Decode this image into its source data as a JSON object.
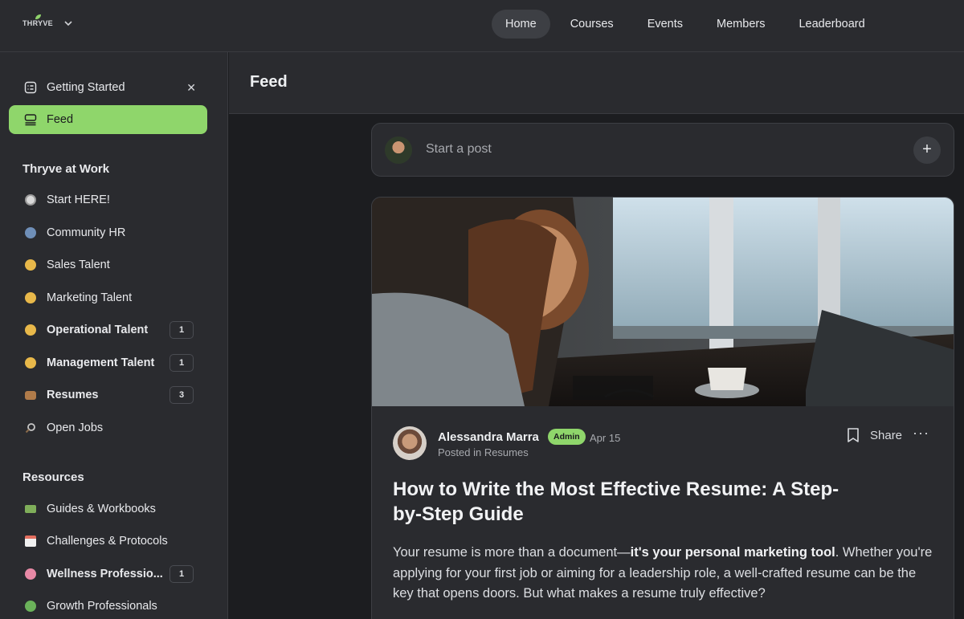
{
  "brand": {
    "logo_text": "THRYVE"
  },
  "nav": {
    "items": [
      {
        "label": "Home",
        "active": true
      },
      {
        "label": "Courses"
      },
      {
        "label": "Events"
      },
      {
        "label": "Members"
      },
      {
        "label": "Leaderboard"
      }
    ]
  },
  "sidebar": {
    "getting_started": "Getting Started",
    "feed": "Feed",
    "section1": "Thryve at Work",
    "section1_items": [
      {
        "label": "Start HERE!",
        "icon": "compass-icon",
        "color": "#d9d9d9"
      },
      {
        "label": "Community HR",
        "icon": "speech-icon",
        "color": "#6f8fb8"
      },
      {
        "label": "Sales Talent",
        "icon": "money-face-icon",
        "color": "#e8b84a"
      },
      {
        "label": "Marketing Talent",
        "icon": "smirk-face-icon",
        "color": "#e8b84a"
      },
      {
        "label": "Operational Talent",
        "icon": "nerd-face-icon",
        "color": "#e8b84a",
        "badge": "1",
        "bold": true
      },
      {
        "label": "Management Talent",
        "icon": "cowboy-face-icon",
        "color": "#e8b84a",
        "badge": "1",
        "bold": true
      },
      {
        "label": "Resumes",
        "icon": "briefcase-icon",
        "color": "#b07b4a",
        "badge": "3",
        "bold": true
      },
      {
        "label": "Open Jobs",
        "icon": "magnifier-icon",
        "color": "#c7c7c7"
      }
    ],
    "section2": "Resources",
    "section2_items": [
      {
        "label": "Guides & Workbooks",
        "icon": "books-icon",
        "color": "#7fae5a"
      },
      {
        "label": "Challenges & Protocols",
        "icon": "calendar-icon",
        "color": "#e36f5f"
      },
      {
        "label": "Wellness Professio...",
        "icon": "brain-icon",
        "color": "#e889a6",
        "badge": "1",
        "bold": true
      },
      {
        "label": "Growth Professionals",
        "icon": "plant-icon",
        "color": "#6bb25a"
      }
    ]
  },
  "main": {
    "title": "Feed",
    "post_placeholder": "Start a post"
  },
  "post": {
    "author": "Alessandra Marra",
    "role_badge": "Admin",
    "date": "Apr 15",
    "posted_in": "Posted in Resumes",
    "share_label": "Share",
    "more_label": "···",
    "title": "How to Write the Most Effective Resume: A Step-by-Step Guide",
    "body_prefix": "Your resume is more than a document—",
    "body_bold": "it's your personal marketing tool",
    "body_suffix": ". Whether you're applying for your first job or aiming for a leadership role, a well-crafted resume can be the key that opens doors. But what makes a resume truly effective?"
  },
  "colors": {
    "accent": "#8fd66b",
    "bg": "#1c1d20",
    "panel": "#2a2b2f"
  }
}
